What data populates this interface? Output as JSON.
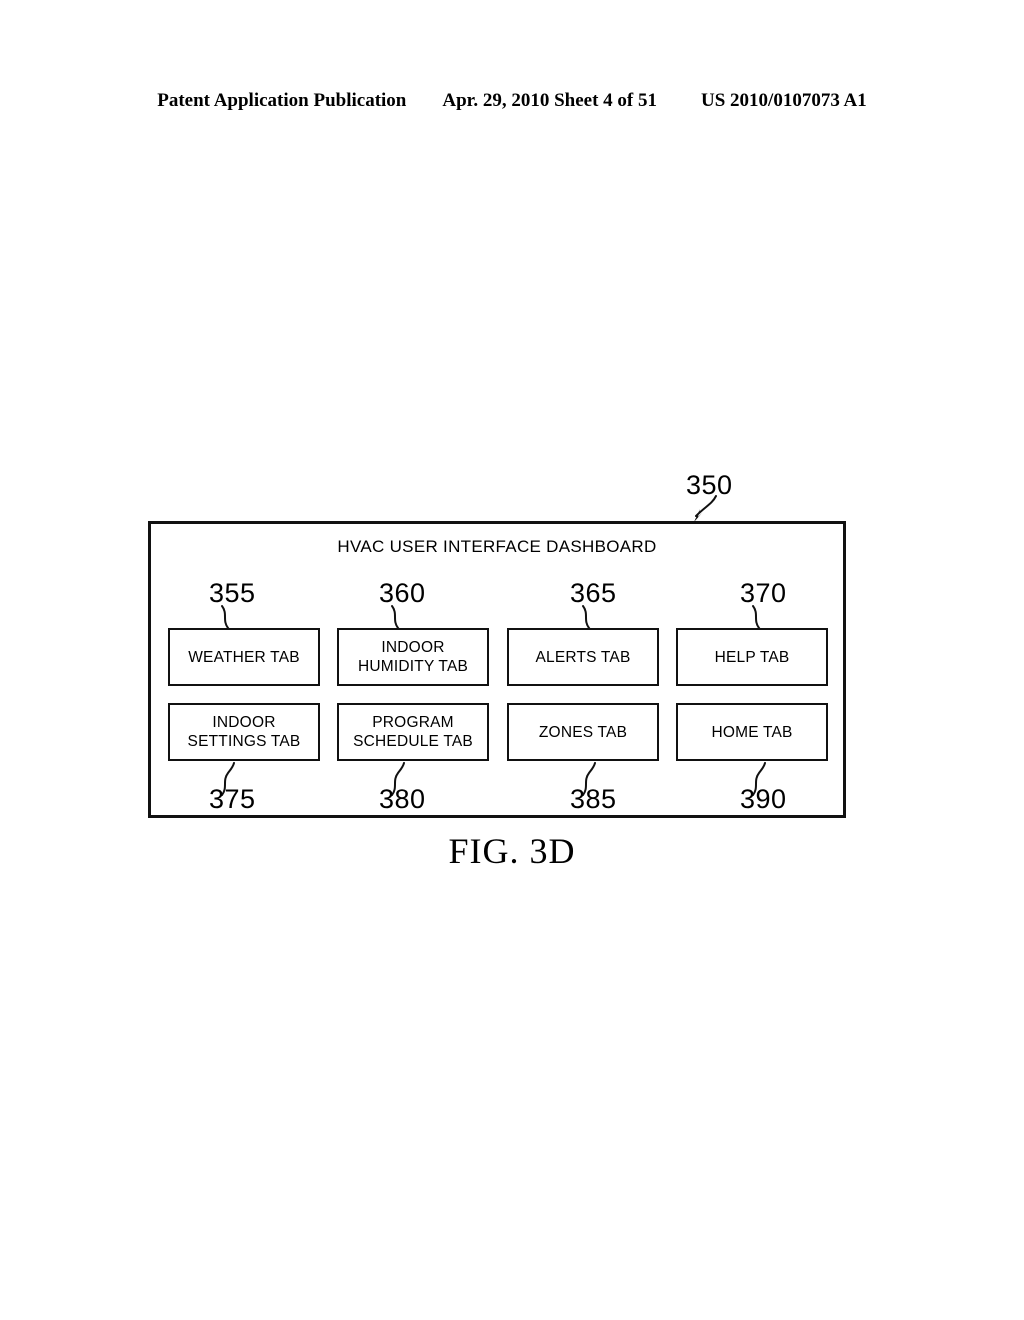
{
  "page_header": {
    "publication": "Patent Application Publication",
    "date_sheet": "Apr. 29, 2010  Sheet 4 of 51",
    "patent_number": "US 2010/0107073 A1"
  },
  "figure": {
    "caption": "FIG. 3D",
    "dashboard": {
      "title": "HVAC USER INTERFACE DASHBOARD",
      "reference_number": "350"
    },
    "tabs": [
      {
        "label": "WEATHER TAB",
        "reference_number": "355",
        "row": "top",
        "column": 1
      },
      {
        "label": "INDOOR\nHUMIDITY TAB",
        "reference_number": "360",
        "row": "top",
        "column": 2
      },
      {
        "label": "ALERTS TAB",
        "reference_number": "365",
        "row": "top",
        "column": 3
      },
      {
        "label": "HELP TAB",
        "reference_number": "370",
        "row": "top",
        "column": 4
      },
      {
        "label": "INDOOR\nSETTINGS TAB",
        "reference_number": "375",
        "row": "bottom",
        "column": 1
      },
      {
        "label": "PROGRAM\nSCHEDULE TAB",
        "reference_number": "380",
        "row": "bottom",
        "column": 2
      },
      {
        "label": "ZONES TAB",
        "reference_number": "385",
        "row": "bottom",
        "column": 3
      },
      {
        "label": "HOME TAB",
        "reference_number": "390",
        "row": "bottom",
        "column": 4
      }
    ]
  },
  "colors": {
    "ink": "#111111",
    "paper": "#ffffff"
  }
}
